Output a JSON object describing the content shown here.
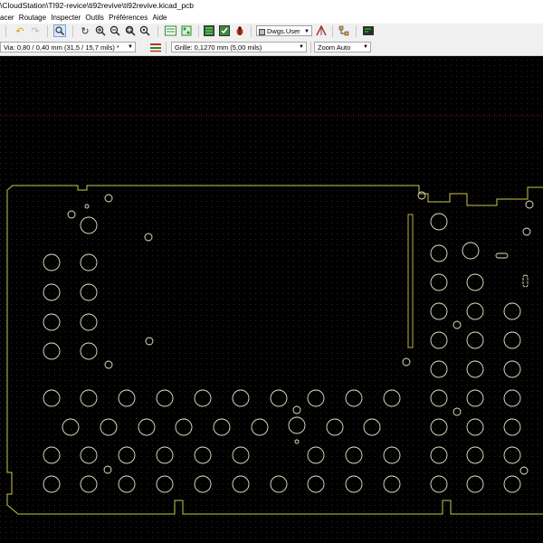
{
  "window": {
    "title": "\\CloudStation\\TI92-revice\\ti92revive\\ti92revive.kicad_pcb"
  },
  "menu": {
    "items": [
      "acer",
      "Routage",
      "Inspecter",
      "Outils",
      "Préférences",
      "Aide"
    ]
  },
  "toolbar": {
    "layer_select": "Dwgs.User",
    "icons": [
      "undo-icon",
      "redo-icon",
      "search-icon",
      "redraw-icon",
      "zoom-in-icon",
      "zoom-out-icon",
      "zoom-fit-icon",
      "zoom-selection-icon",
      "netlist-icon",
      "layers-pair-icon",
      "drc-icon",
      "bug-icon",
      "microwave-icon",
      "hierarchy-icon",
      "scripting-icon"
    ]
  },
  "options_bar": {
    "via": "Via: 0,80 / 0,40 mm (31,5 / 15,7 mils) *",
    "grid": "Grille: 0,1270 mm (5,00 mils)",
    "zoom": "Zoom Auto"
  },
  "colors": {
    "canvas": "#000000",
    "outline": "#c8c84a",
    "holes": "#e8e8c8",
    "slot": "#c8c848"
  }
}
